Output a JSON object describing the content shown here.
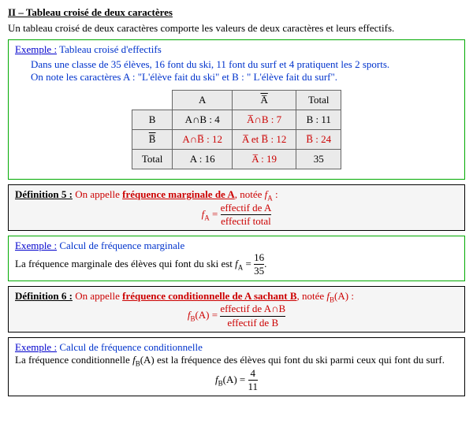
{
  "title": "II – Tableau croisé de deux caractères",
  "intro": "Un tableau croisé de deux caractères comporte les valeurs de deux caractères et leurs effectifs.",
  "exemple1": {
    "label": "Exemple :",
    "title": "Tableau croisé d'effectifs",
    "line1": "Dans une classe de 35 élèves, 16 font du ski, 11 font du surf et 4 pratiquent les 2 sports.",
    "line2": "On note les caractères A : \"L'élève fait du ski\" et B : \" L'élève fait du surf\"."
  },
  "table": {
    "col1": "A",
    "col2": "A̅",
    "col3": "Total",
    "row1": "B",
    "row2": "B̅",
    "row3": "Total",
    "c11": "A∩B : 4",
    "c12": "A̅∩B : 7",
    "c13": "B : 11",
    "c21": "A∩B̅ : 12",
    "c22a": "A̅",
    "c22b": " et ",
    "c22c": "B̅",
    "c22d": " : 12",
    "c23": "B̅ : 24",
    "c31": "A : 16",
    "c32": "A̅ : 19",
    "c33": "35"
  },
  "def5": {
    "label": "Définition 5 :",
    "text1": "On appelle ",
    "term": "fréquence marginale de A",
    "text2": ", notée ",
    "var": "f",
    "sub": "A",
    "text3": " :",
    "num": "effectif de A",
    "den": "effectif total",
    "eq_left": "f",
    "eq_sub": "A",
    "eq_mid": " = "
  },
  "exemple2": {
    "label": "Exemple :",
    "title": "Calcul de fréquence marginale",
    "text": "La fréquence marginale des élèves qui font du ski est ",
    "var": "f",
    "sub": "A",
    "eq": " = ",
    "num": "16",
    "den": "35",
    "period": "."
  },
  "def6": {
    "label": "Définition 6 :",
    "text1": "On appelle ",
    "term": "fréquence conditionnelle de A sachant B",
    "text2": ", notée ",
    "var": "f",
    "sub": "B",
    "arg": "(A)",
    "text3": " :",
    "eq_left": "f",
    "eq_sub": "B",
    "eq_arg": "(A) = ",
    "num": "effectif de A∩B",
    "den": "effectif de B"
  },
  "exemple3": {
    "label": "Exemple :",
    "title": "Calcul de fréquence conditionnelle",
    "text1": "La fréquence conditionnelle ",
    "var": "f",
    "sub": "B",
    "arg": "(A)",
    "text2": " est la fréquence des élèves qui font du ski parmi ceux qui font du surf.",
    "eq_left": "f",
    "eq_sub": "B",
    "eq_arg": "(A) = ",
    "num": "4",
    "den": "11"
  }
}
